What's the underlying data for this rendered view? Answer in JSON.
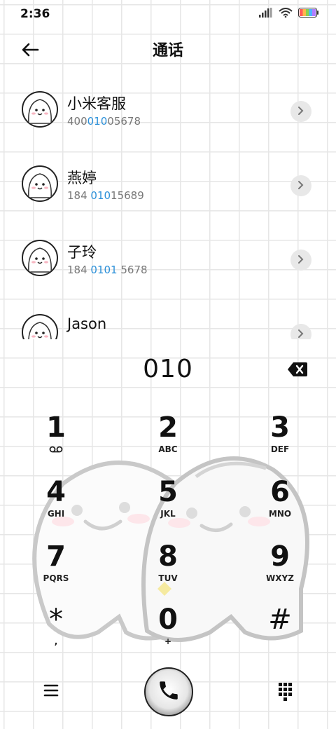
{
  "status": {
    "time": "2:36"
  },
  "header": {
    "title": "通话"
  },
  "contacts": [
    {
      "name": "小米客服",
      "number_pre": "400",
      "number_hl": "010",
      "number_post": "05678"
    },
    {
      "name": "燕婷",
      "number_pre": "184 ",
      "number_hl": "010",
      "number_post": "15689"
    },
    {
      "name": "子玲",
      "number_pre": "184 ",
      "number_hl": "0101",
      "number_post": " 5678"
    },
    {
      "name": "Jason",
      "number_pre": "",
      "number_hl": "",
      "number_post": ""
    }
  ],
  "dial": {
    "typed": "010"
  },
  "keypad": [
    {
      "digit": "1",
      "letters": ""
    },
    {
      "digit": "2",
      "letters": "ABC"
    },
    {
      "digit": "3",
      "letters": "DEF"
    },
    {
      "digit": "4",
      "letters": "GHI"
    },
    {
      "digit": "5",
      "letters": "JKL"
    },
    {
      "digit": "6",
      "letters": "MNO"
    },
    {
      "digit": "7",
      "letters": "PQRS"
    },
    {
      "digit": "8",
      "letters": "TUV"
    },
    {
      "digit": "9",
      "letters": "WXYZ"
    },
    {
      "digit": "*",
      "letters": ","
    },
    {
      "digit": "0",
      "letters": "+"
    },
    {
      "digit": "#",
      "letters": ""
    }
  ],
  "colors": {
    "highlight": "#2b90d9",
    "battery": [
      "#ff5a5a",
      "#ffb84d",
      "#8ad14f",
      "#4fb3ff",
      "#b07cff"
    ]
  }
}
